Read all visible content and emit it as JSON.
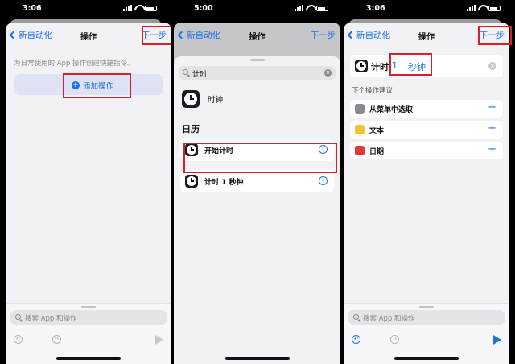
{
  "colors": {
    "accent": "#1a73e8",
    "highlight": "#d8202a",
    "menu_icon": "#8a8a8e",
    "text_icon": "#f4c430",
    "date_icon": "#e53935"
  },
  "screens": [
    {
      "time": "3:06",
      "back": "新自动化",
      "title": "操作",
      "next": "下一步",
      "hint": "为日常使用的 App 操作创建快捷指令。",
      "add_button": "添加操作",
      "search_placeholder": "搜索 App 和操作"
    },
    {
      "time": "5:00",
      "back": "新自动化",
      "title": "操作",
      "next": "下一步",
      "search_value": "计时",
      "app_result": "时钟",
      "section": "日历",
      "actions": [
        "开始计时",
        "计时 1 秒钟"
      ]
    },
    {
      "time": "3:06",
      "back": "新自动化",
      "title": "操作",
      "next": "下一步",
      "action_label": "计时",
      "action_value": "1",
      "action_unit": "秒钟",
      "suggestions_title": "下个操作建议",
      "suggestions": [
        {
          "label": "从菜单中选取",
          "icon": "menu-icon"
        },
        {
          "label": "文本",
          "icon": "text-icon"
        },
        {
          "label": "日期",
          "icon": "date-icon"
        }
      ],
      "search_placeholder": "搜索 App 和操作"
    }
  ]
}
